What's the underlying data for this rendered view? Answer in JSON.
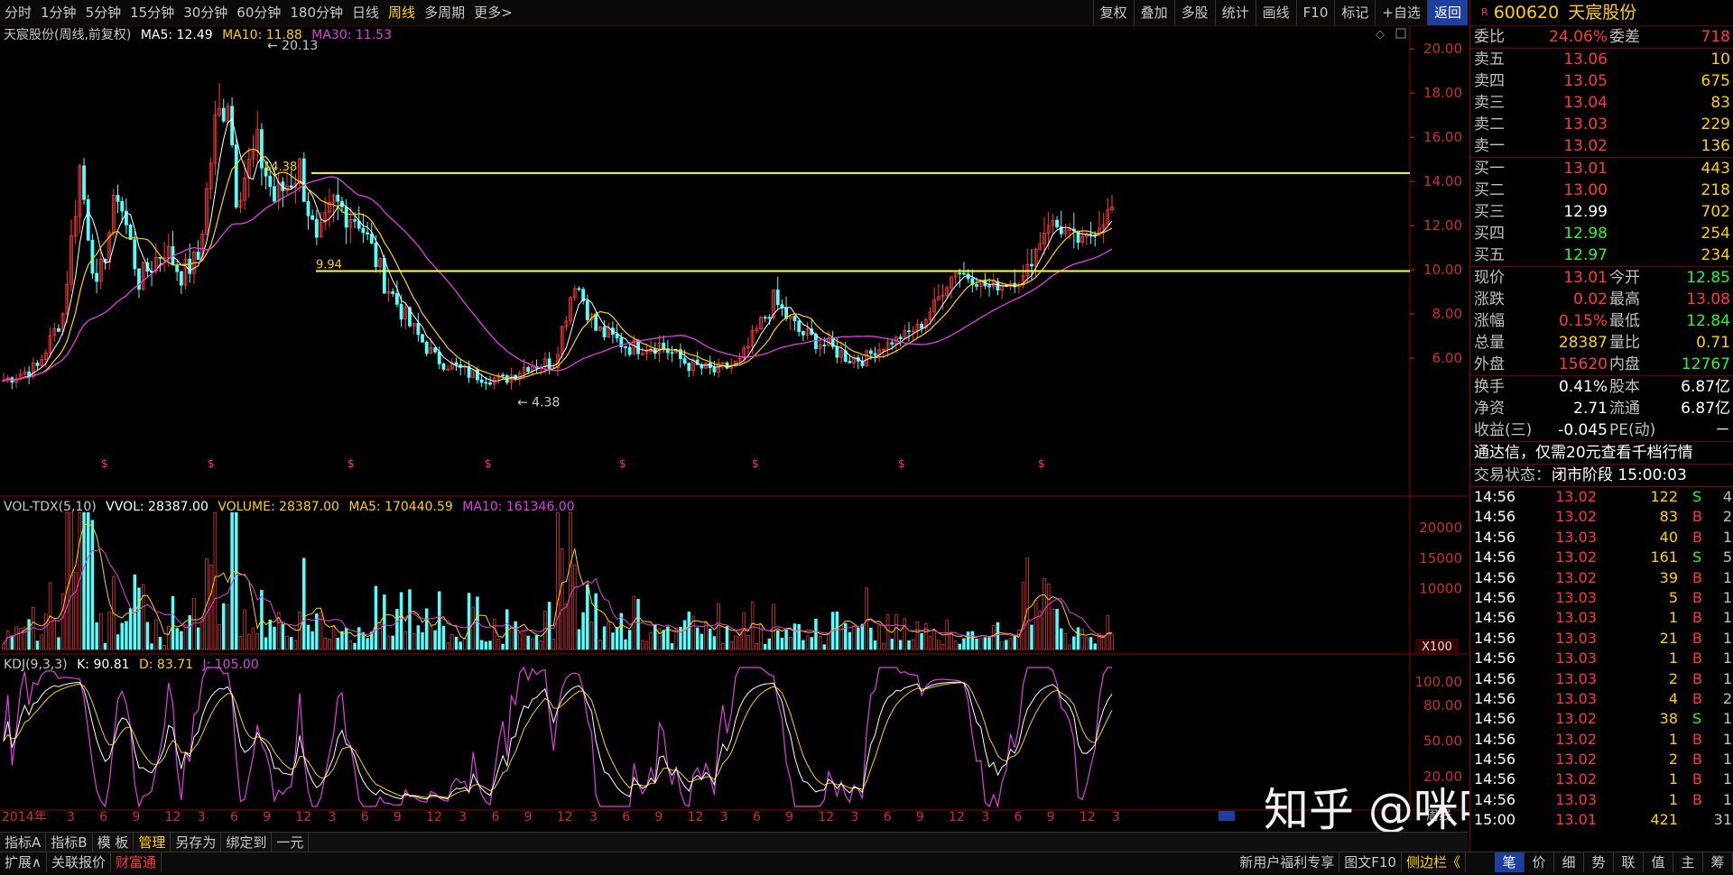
{
  "period_tabs": [
    "分时",
    "1分钟",
    "5分钟",
    "15分钟",
    "30分钟",
    "60分钟",
    "180分钟",
    "日线",
    "周线",
    "多周期",
    "更多>"
  ],
  "active_period": "周线",
  "toolbar": [
    "复权",
    "叠加",
    "多股",
    "统计",
    "画线",
    "F10",
    "标记",
    "+自选",
    "返回"
  ],
  "stock": {
    "flag": "R",
    "code": "600620",
    "name": "天宸股份"
  },
  "main_pane": {
    "title": "天宸股份(周线,前复权)",
    "ma5": "MA5: 12.49",
    "ma10": "MA10: 11.88",
    "ma30": "MA30: 11.53",
    "y_ticks": [
      "20.00",
      "18.00",
      "16.00",
      "14.00",
      "12.00",
      "10.00",
      "8.00",
      "6.00"
    ],
    "annotations": [
      "20.13",
      "14.38",
      "9.94",
      "4.38"
    ],
    "resistance": 14.38,
    "support": 9.94,
    "price_range": [
      4.38,
      20.13
    ],
    "colors": {
      "ma5": "#ffffff",
      "ma10": "#ffd000",
      "ma30": "#e040e0",
      "up": "#ff3a3a",
      "down": "#54ffff",
      "hline": "#ffff40"
    }
  },
  "vol_pane": {
    "title": "VOL-TDX(5,10)",
    "vvol": "VVOL: 28387.00",
    "volume": "VOLUME: 28387.00",
    "ma5": "MA5: 170440.59",
    "ma10": "MA10: 161346.00",
    "y_ticks": [
      "20000",
      "15000",
      "10000"
    ],
    "unit": "X100"
  },
  "kdj_pane": {
    "title": "KDJ(9,3,3)",
    "k": "K: 90.81",
    "d": "D: 83.71",
    "j": "J: 105.00",
    "y_ticks": [
      "100.00",
      "80.00",
      "50.00",
      "20.00"
    ]
  },
  "time_axis": [
    "2014年",
    "3",
    "6",
    "9",
    "12",
    "3",
    "6",
    "9",
    "12",
    "3",
    "6",
    "9",
    "12",
    "3",
    "6",
    "9",
    "12",
    "3",
    "6",
    "9",
    "12",
    "3",
    "6",
    "9",
    "12",
    "3",
    "6",
    "9",
    "12",
    "3",
    "6",
    "9",
    "12",
    "3"
  ],
  "time_mode": "周线",
  "quote": {
    "weibi": {
      "label": "委比",
      "value": "24.06%",
      "label2": "委差",
      "value2": "718"
    },
    "asks": [
      {
        "label": "卖五",
        "price": "13.06",
        "vol": "10"
      },
      {
        "label": "卖四",
        "price": "13.05",
        "vol": "675"
      },
      {
        "label": "卖三",
        "price": "13.04",
        "vol": "83"
      },
      {
        "label": "卖二",
        "price": "13.03",
        "vol": "229"
      },
      {
        "label": "卖一",
        "price": "13.02",
        "vol": "136"
      }
    ],
    "bids": [
      {
        "label": "买一",
        "price": "13.01",
        "vol": "443",
        "color": "red"
      },
      {
        "label": "买二",
        "price": "13.00",
        "vol": "218",
        "color": "red"
      },
      {
        "label": "买三",
        "price": "12.99",
        "vol": "702",
        "color": "white"
      },
      {
        "label": "买四",
        "price": "12.98",
        "vol": "254",
        "color": "green"
      },
      {
        "label": "买五",
        "price": "12.97",
        "vol": "234",
        "color": "green"
      }
    ],
    "stats": [
      {
        "l1": "现价",
        "v1": "13.01",
        "c1": "red",
        "l2": "今开",
        "v2": "12.85",
        "c2": "green"
      },
      {
        "l1": "涨跌",
        "v1": "0.02",
        "c1": "red",
        "l2": "最高",
        "v2": "13.08",
        "c2": "red"
      },
      {
        "l1": "涨幅",
        "v1": "0.15%",
        "c1": "red",
        "l2": "最低",
        "v2": "12.84",
        "c2": "green"
      },
      {
        "l1": "总量",
        "v1": "28387",
        "c1": "yellow",
        "l2": "量比",
        "v2": "0.71",
        "c2": "yellow"
      },
      {
        "l1": "外盘",
        "v1": "15620",
        "c1": "red",
        "l2": "内盘",
        "v2": "12767",
        "c2": "green"
      }
    ],
    "stats2": [
      {
        "l1": "换手",
        "v1": "0.41%",
        "l2": "股本",
        "v2": "6.87亿"
      },
      {
        "l1": "净资",
        "v1": "2.71",
        "l2": "流通",
        "v2": "6.87亿"
      },
      {
        "l1": "收益(三)",
        "v1": "-0.045",
        "l2": "PE(动)",
        "v2": "－"
      }
    ],
    "promo": "通达信，仅需20元查看千档行情",
    "status_label": "交易状态：",
    "status": "闭市阶段 15:00:03"
  },
  "ticks": [
    {
      "t": "14:56",
      "p": "13.02",
      "v": "122",
      "s": "S",
      "n": "4"
    },
    {
      "t": "14:56",
      "p": "13.02",
      "v": "83",
      "s": "B",
      "n": "2"
    },
    {
      "t": "14:56",
      "p": "13.03",
      "v": "40",
      "s": "B",
      "n": "1"
    },
    {
      "t": "14:56",
      "p": "13.02",
      "v": "161",
      "s": "S",
      "n": "5"
    },
    {
      "t": "14:56",
      "p": "13.02",
      "v": "39",
      "s": "B",
      "n": "1"
    },
    {
      "t": "14:56",
      "p": "13.03",
      "v": "5",
      "s": "B",
      "n": "1"
    },
    {
      "t": "14:56",
      "p": "13.03",
      "v": "1",
      "s": "B",
      "n": "1"
    },
    {
      "t": "14:56",
      "p": "13.03",
      "v": "21",
      "s": "B",
      "n": "1"
    },
    {
      "t": "14:56",
      "p": "13.03",
      "v": "1",
      "s": "B",
      "n": "1"
    },
    {
      "t": "14:56",
      "p": "13.03",
      "v": "2",
      "s": "B",
      "n": "1"
    },
    {
      "t": "14:56",
      "p": "13.03",
      "v": "4",
      "s": "B",
      "n": "2"
    },
    {
      "t": "14:56",
      "p": "13.02",
      "v": "38",
      "s": "S",
      "n": "1"
    },
    {
      "t": "14:56",
      "p": "13.02",
      "v": "1",
      "s": "B",
      "n": "1"
    },
    {
      "t": "14:56",
      "p": "13.02",
      "v": "2",
      "s": "B",
      "n": "1"
    },
    {
      "t": "14:56",
      "p": "13.02",
      "v": "1",
      "s": "B",
      "n": "1"
    },
    {
      "t": "14:56",
      "p": "13.03",
      "v": "1",
      "s": "B",
      "n": "1"
    },
    {
      "t": "15:00",
      "p": "13.01",
      "v": "421",
      "s": "",
      "n": "31"
    }
  ],
  "bottom_tabs1": [
    "指标A",
    "指标B",
    "模 板",
    "管理",
    "另存为",
    "绑定到",
    "一元"
  ],
  "bottom_tabs1_active": "管理",
  "bottom_tabs2": [
    "扩展∧",
    "关联报价",
    "财富通"
  ],
  "bottom_right": [
    "新用户福利专享",
    "图文F10",
    "侧边栏《"
  ],
  "right_tabs": [
    "笔",
    "价",
    "细",
    "势",
    "联",
    "值",
    "主",
    "筹"
  ],
  "watermark": "知乎 @咪咪小超人"
}
